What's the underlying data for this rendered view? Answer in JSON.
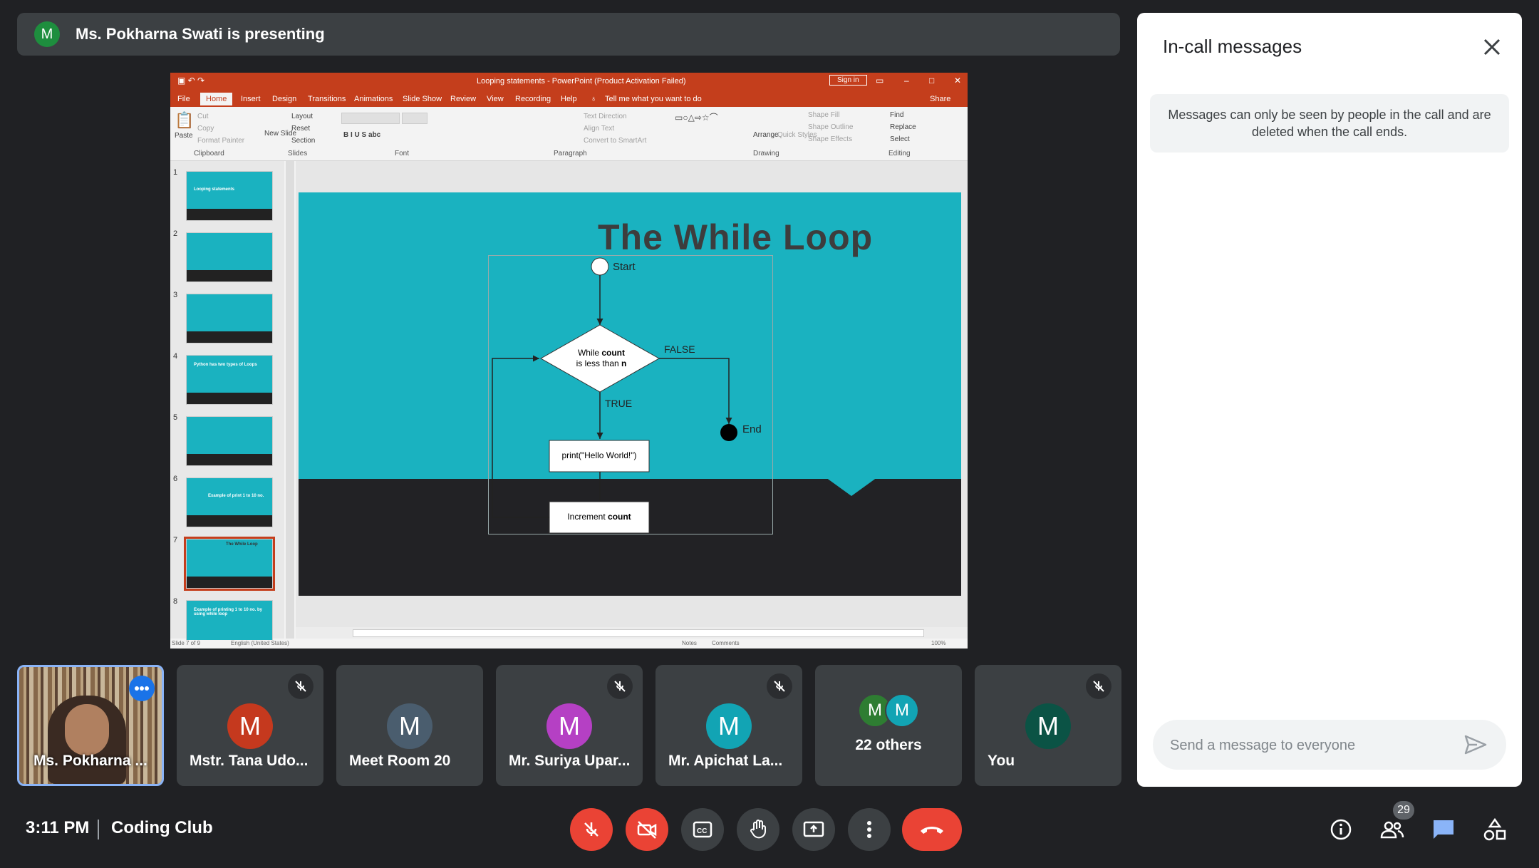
{
  "banner": {
    "avatar_letter": "M",
    "text": "Ms. Pokharna Swati is presenting"
  },
  "powerpoint": {
    "window_title": "Looping statements - PowerPoint (Product Activation Failed)",
    "sign_in": "Sign in",
    "share": "Share",
    "tabs": [
      "File",
      "Home",
      "Insert",
      "Design",
      "Transitions",
      "Animations",
      "Slide Show",
      "Review",
      "View",
      "Recording",
      "Help"
    ],
    "tell_me": "Tell me what you want to do",
    "ribbon": {
      "paste": "Paste",
      "cut": "Cut",
      "copy": "Copy",
      "format_painter": "Format Painter",
      "new_slide": "New Slide",
      "layout": "Layout",
      "reset": "Reset",
      "section": "Section",
      "text_direction": "Text Direction",
      "align_text": "Align Text",
      "convert_smartart": "Convert to SmartArt",
      "arrange": "Arrange",
      "quick_styles": "Quick Styles",
      "shape_fill": "Shape Fill",
      "shape_outline": "Shape Outline",
      "shape_effects": "Shape Effects",
      "find": "Find",
      "replace": "Replace",
      "select": "Select",
      "groups": [
        "Clipboard",
        "Slides",
        "Font",
        "Paragraph",
        "Drawing",
        "Editing"
      ]
    },
    "thumbnails": [
      {
        "num": "1",
        "title": "Looping statements"
      },
      {
        "num": "2",
        "title": ""
      },
      {
        "num": "3",
        "title": ""
      },
      {
        "num": "4",
        "title": "Python has two types of Loops"
      },
      {
        "num": "5",
        "title": ""
      },
      {
        "num": "6",
        "title": "Example of print 1 to 10 no."
      },
      {
        "num": "7",
        "title": "The While Loop"
      },
      {
        "num": "8",
        "title": "Example of printing 1 to 10 no. by using while loop"
      }
    ],
    "slide": {
      "title": "The While Loop",
      "start": "Start",
      "decision_line1_pre": "While ",
      "decision_line1_bold": "count",
      "decision_line2_pre": "is less than ",
      "decision_line2_bold": "n",
      "false_label": "FALSE",
      "true_label": "TRUE",
      "end": "End",
      "print_box": "print(\"Hello World!\")",
      "increment_pre": "Increment ",
      "increment_bold": "count"
    },
    "status_left": "Slide 7 of 9",
    "status_lang": "English (United States)",
    "status_notes": "Notes",
    "status_comments": "Comments",
    "zoom": "100%"
  },
  "participants": [
    {
      "name": "Ms. Pokharna ...",
      "letter": "",
      "color": ""
    },
    {
      "name": "Mstr. Tana Udo...",
      "letter": "M",
      "color": "#c5391e"
    },
    {
      "name": "Meet Room 20",
      "letter": "M",
      "color": "#4a5d6e"
    },
    {
      "name": "Mr. Suriya Upar...",
      "letter": "M",
      "color": "#b540c4"
    },
    {
      "name": "Mr. Apichat La...",
      "letter": "M",
      "color": "#12a4b4"
    },
    {
      "name": "22 others",
      "letter": "M",
      "color": "#2e7d32"
    },
    {
      "name": "You",
      "letter": "M",
      "color": "#0b5345"
    }
  ],
  "others_second_color": "#12a4b4",
  "bottom": {
    "time": "3:11 PM",
    "meeting": "Coding Club",
    "people_count": "29"
  },
  "chat": {
    "title": "In-call messages",
    "note": "Messages can only be seen by people in the call and are deleted when the call ends.",
    "placeholder": "Send a message to everyone"
  }
}
